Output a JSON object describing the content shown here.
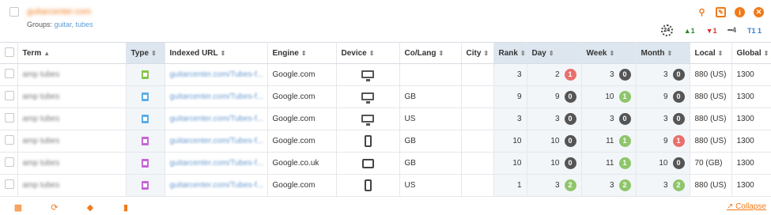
{
  "header": {
    "site": "guitarcenter.com",
    "groups_label": "Groups:",
    "groups_value": "guitar, tubes",
    "icons": [
      "search-icon",
      "edit-icon",
      "info-icon",
      "close-icon"
    ],
    "clock_label": "24",
    "stats": {
      "up": "▲1",
      "down": "▼1",
      "same": "━4",
      "top": "T1 1"
    }
  },
  "table": {
    "columns": [
      "Term",
      "Type",
      "Indexed URL",
      "Engine",
      "Device",
      "Co/Lang",
      "City",
      "Rank",
      "Day",
      "Week",
      "Month",
      "Local",
      "Global"
    ],
    "rows": [
      {
        "term": "amp tubes",
        "type": "green",
        "url": "guitarcenter.com/Tubes-f...",
        "engine": "Google.com",
        "device": "desktop",
        "colang": "",
        "city": "",
        "rank": "3",
        "day": "2",
        "day_badge": "1",
        "day_color": "red",
        "week": "3",
        "week_badge": "0",
        "week_color": "gray",
        "month": "3",
        "month_badge": "0",
        "month_color": "gray",
        "local": "880 (US)",
        "global": "1300"
      },
      {
        "term": "amp tubes",
        "type": "blue",
        "url": "guitarcenter.com/Tubes-f...",
        "engine": "Google.com",
        "device": "desktop",
        "colang": "GB",
        "city": "",
        "rank": "9",
        "day": "9",
        "day_badge": "0",
        "day_color": "gray",
        "week": "10",
        "week_badge": "1",
        "week_color": "green",
        "month": "9",
        "month_badge": "0",
        "month_color": "gray",
        "local": "880 (US)",
        "global": "1300"
      },
      {
        "term": "amp tubes",
        "type": "blue",
        "url": "guitarcenter.com/Tubes-f...",
        "engine": "Google.com",
        "device": "desktop",
        "colang": "US",
        "city": "",
        "rank": "3",
        "day": "3",
        "day_badge": "0",
        "day_color": "gray",
        "week": "3",
        "week_badge": "0",
        "week_color": "gray",
        "month": "3",
        "month_badge": "0",
        "month_color": "gray",
        "local": "880 (US)",
        "global": "1300"
      },
      {
        "term": "amp tubes",
        "type": "purple",
        "url": "guitarcenter.com/Tubes-f...",
        "engine": "Google.com",
        "device": "phone",
        "colang": "GB",
        "city": "",
        "rank": "10",
        "day": "10",
        "day_badge": "0",
        "day_color": "gray",
        "week": "11",
        "week_badge": "1",
        "week_color": "green",
        "month": "9",
        "month_badge": "1",
        "month_color": "red",
        "local": "880 (US)",
        "global": "1300"
      },
      {
        "term": "amp tubes",
        "type": "purple",
        "url": "guitarcenter.com/Tubes-f...",
        "engine": "Google.co.uk",
        "device": "tablet",
        "colang": "GB",
        "city": "",
        "rank": "10",
        "day": "10",
        "day_badge": "0",
        "day_color": "gray",
        "week": "11",
        "week_badge": "1",
        "week_color": "green",
        "month": "10",
        "month_badge": "0",
        "month_color": "gray",
        "local": "70 (GB)",
        "global": "1300"
      },
      {
        "term": "amp tubes",
        "type": "purple",
        "url": "guitarcenter.com/Tubes-f...",
        "engine": "Google.com",
        "device": "phone",
        "colang": "US",
        "city": "",
        "rank": "1",
        "day": "3",
        "day_badge": "2",
        "day_color": "green",
        "week": "3",
        "week_badge": "2",
        "week_color": "green",
        "month": "3",
        "month_badge": "2",
        "month_color": "green",
        "local": "880 (US)",
        "global": "1300"
      }
    ]
  },
  "footer": {
    "icons": [
      "chart-icon",
      "refresh-icon",
      "tag-icon",
      "trash-icon"
    ],
    "collapse_label": "Collapse"
  },
  "colors": {
    "accent": "#f07a1a",
    "badge_gray": "#555555",
    "badge_red": "#e8706c",
    "badge_green": "#8fc56b",
    "header_shade": "#dde6ef"
  }
}
